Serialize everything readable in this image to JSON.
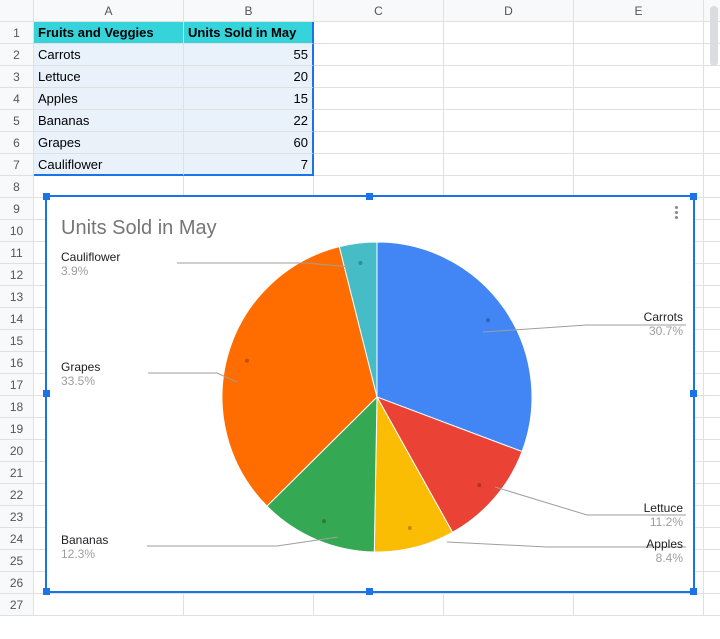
{
  "columns": [
    "A",
    "B",
    "C",
    "D",
    "E",
    ""
  ],
  "rows": [
    "1",
    "2",
    "3",
    "4",
    "5",
    "6",
    "7",
    "8",
    "9",
    "10",
    "11",
    "12",
    "13",
    "14",
    "15",
    "16",
    "17",
    "18",
    "19",
    "20",
    "21",
    "22",
    "23",
    "24",
    "25",
    "26",
    "27"
  ],
  "table": {
    "header_a": "Fruits and Veggies",
    "header_b": "Units Sold in May",
    "data": [
      {
        "a": "Carrots",
        "b": "55"
      },
      {
        "a": "Lettuce",
        "b": "20"
      },
      {
        "a": "Apples",
        "b": "15"
      },
      {
        "a": "Bananas",
        "b": "22"
      },
      {
        "a": "Grapes",
        "b": "60"
      },
      {
        "a": "Cauliflower",
        "b": "7"
      }
    ]
  },
  "chart": {
    "title": "Units Sold in May",
    "labels": {
      "carrots": {
        "name": "Carrots",
        "pct": "30.7%"
      },
      "lettuce": {
        "name": "Lettuce",
        "pct": "11.2%"
      },
      "apples": {
        "name": "Apples",
        "pct": "8.4%"
      },
      "bananas": {
        "name": "Bananas",
        "pct": "12.3%"
      },
      "grapes": {
        "name": "Grapes",
        "pct": "33.5%"
      },
      "cauliflower": {
        "name": "Cauliflower",
        "pct": "3.9%"
      }
    }
  },
  "chart_data": {
    "type": "pie",
    "title": "Units Sold in May",
    "categories": [
      "Carrots",
      "Lettuce",
      "Apples",
      "Bananas",
      "Grapes",
      "Cauliflower"
    ],
    "values": [
      55,
      20,
      15,
      22,
      60,
      7
    ],
    "percentages": [
      30.7,
      11.2,
      8.4,
      12.3,
      33.5,
      3.9
    ],
    "colors": [
      "#4285f4",
      "#ea4335",
      "#fbbc04",
      "#34a853",
      "#ff6d01",
      "#46bdc6"
    ]
  }
}
